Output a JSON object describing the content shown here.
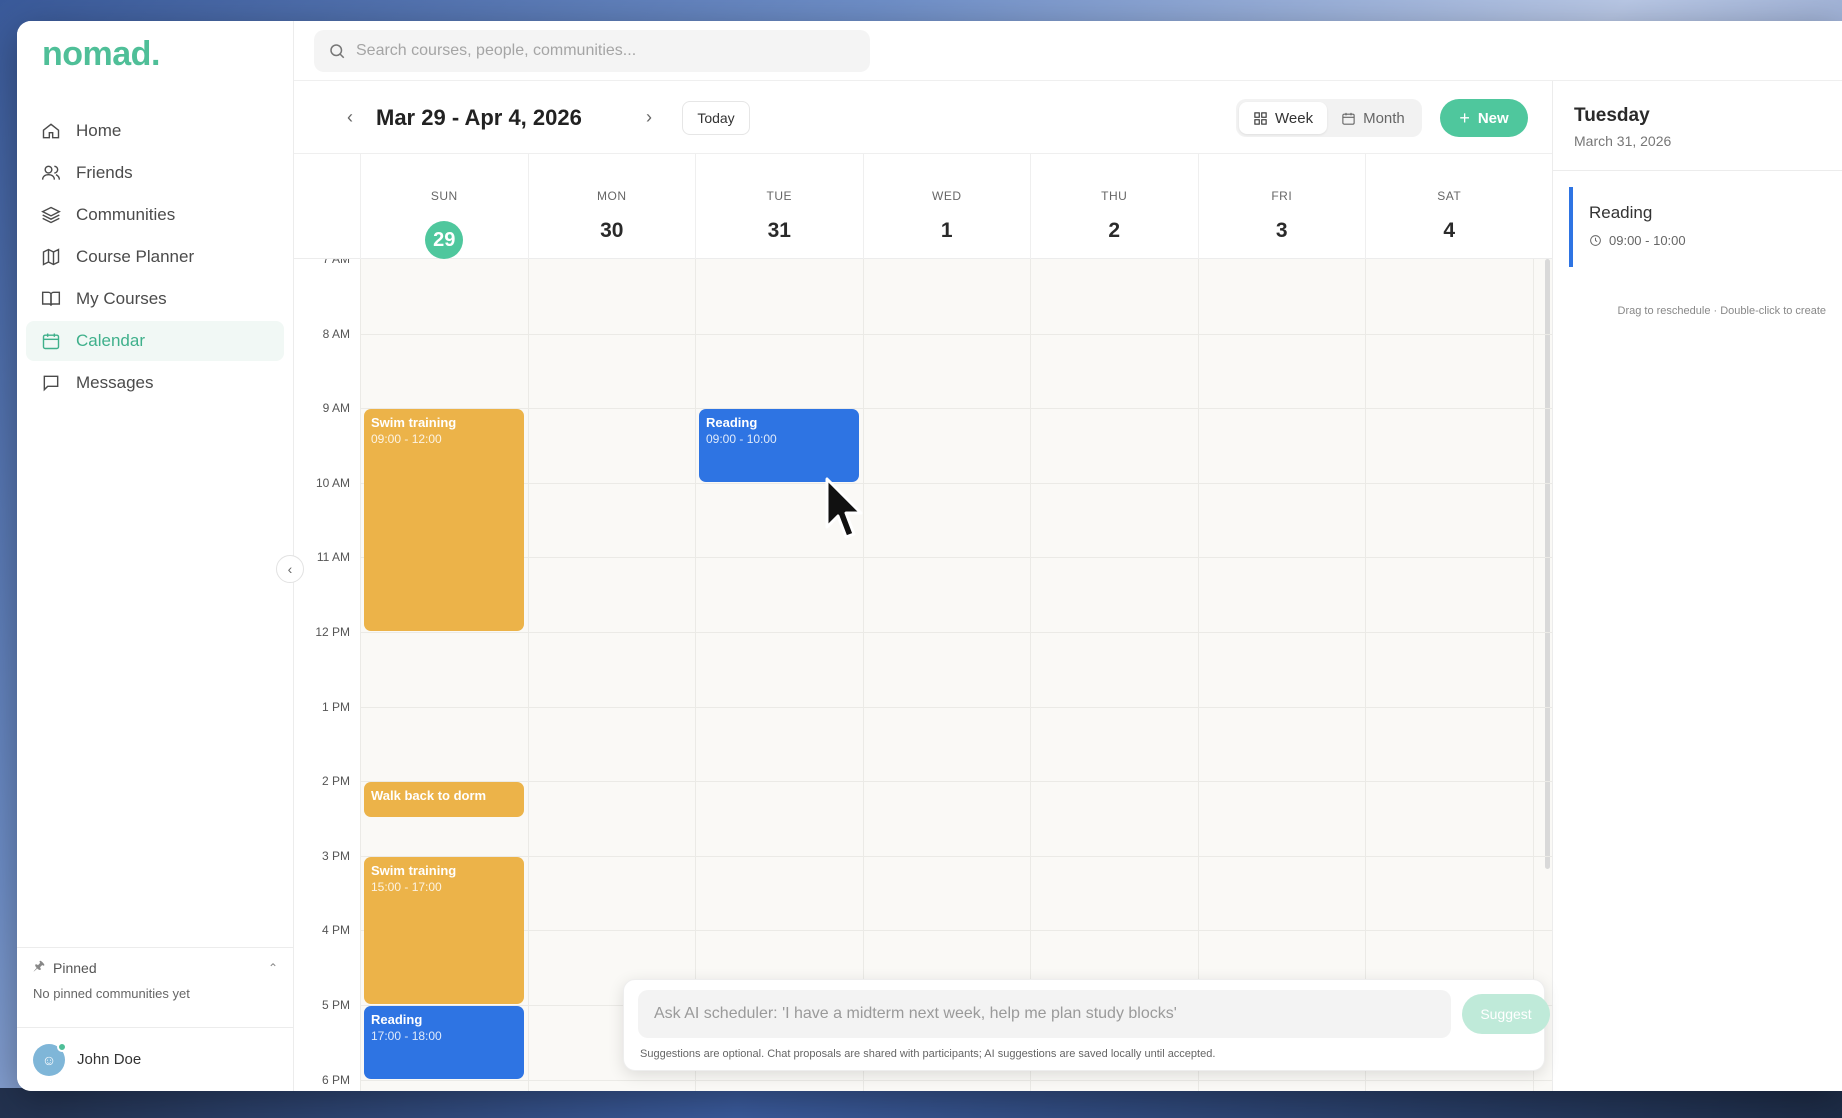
{
  "app": {
    "logo": "nomad."
  },
  "search": {
    "placeholder": "Search courses, people, communities..."
  },
  "sidebar": {
    "items": [
      {
        "label": "Home",
        "icon": "home-icon",
        "active": false
      },
      {
        "label": "Friends",
        "icon": "friends-icon",
        "active": false
      },
      {
        "label": "Communities",
        "icon": "layers-icon",
        "active": false
      },
      {
        "label": "Course Planner",
        "icon": "map-icon",
        "active": false
      },
      {
        "label": "My Courses",
        "icon": "book-icon",
        "active": false
      },
      {
        "label": "Calendar",
        "icon": "calendar-icon",
        "active": true
      },
      {
        "label": "Messages",
        "icon": "message-icon",
        "active": false
      }
    ],
    "pinned": {
      "title": "Pinned",
      "empty": "No pinned communities yet"
    },
    "user": {
      "name": "John Doe"
    }
  },
  "calendar": {
    "range": "Mar 29 - Apr 4, 2026",
    "today_label": "Today",
    "views": {
      "week": "Week",
      "month": "Month",
      "active": "week"
    },
    "new_label": "New",
    "accent": "#4fc79d",
    "days": [
      {
        "name": "SUN",
        "date": "29",
        "today": true
      },
      {
        "name": "MON",
        "date": "30",
        "today": false
      },
      {
        "name": "TUE",
        "date": "31",
        "today": false
      },
      {
        "name": "WED",
        "date": "1",
        "today": false
      },
      {
        "name": "THU",
        "date": "2",
        "today": false
      },
      {
        "name": "FRI",
        "date": "3",
        "today": false
      },
      {
        "name": "SAT",
        "date": "4",
        "today": false
      }
    ],
    "hours": [
      "7 AM",
      "8 AM",
      "9 AM",
      "10 AM",
      "11 AM",
      "12 PM",
      "1 PM",
      "2 PM",
      "3 PM",
      "4 PM",
      "5 PM",
      "6 PM"
    ],
    "events": [
      {
        "title": "Swim training",
        "time": "09:00 - 12:00",
        "day": 0,
        "start": 9,
        "end": 12,
        "color": "#ecb349"
      },
      {
        "title": "Walk back to dorm",
        "time": "",
        "day": 0,
        "start": 14,
        "end": 14.5,
        "color": "#ecb349"
      },
      {
        "title": "Swim training",
        "time": "15:00 - 17:00",
        "day": 0,
        "start": 15,
        "end": 17,
        "color": "#ecb349"
      },
      {
        "title": "Reading",
        "time": "17:00 - 18:00",
        "day": 0,
        "start": 17,
        "end": 18,
        "color": "#2e74e3"
      },
      {
        "title": "Reading",
        "time": "09:00 - 10:00",
        "day": 2,
        "start": 9,
        "end": 10,
        "color": "#2e74e3"
      }
    ]
  },
  "detail": {
    "day": "Tuesday",
    "date": "March 31, 2026",
    "event_title": "Reading",
    "event_time": "09:00 - 10:00",
    "hint": "Drag to reschedule · Double-click to create"
  },
  "ai": {
    "placeholder": "Ask AI scheduler: 'I have a midterm next week, help me plan study blocks'",
    "button": "Suggest",
    "note": "Suggestions are optional. Chat proposals are shared with participants; AI suggestions are saved locally until accepted."
  }
}
